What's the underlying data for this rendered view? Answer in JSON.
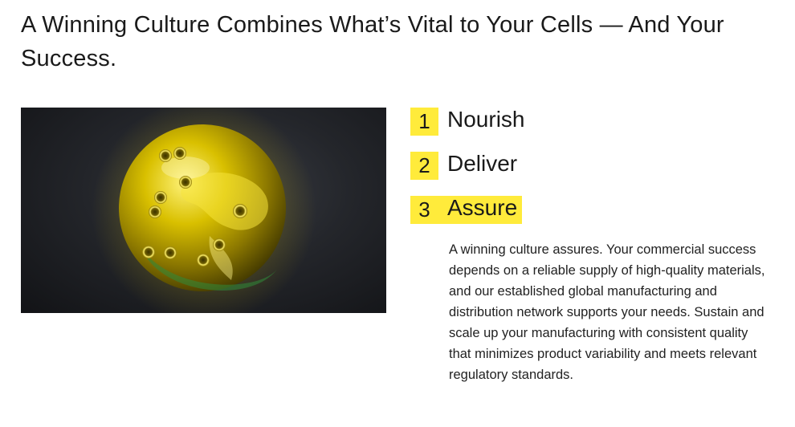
{
  "headline": "A Winning Culture Combines What’s Vital to Your Cells — And Your Success.",
  "steps": [
    {
      "number": "1",
      "label": "Nourish"
    },
    {
      "number": "2",
      "label": "Deliver"
    },
    {
      "number": "3",
      "label": "Assure"
    }
  ],
  "active_step": 3,
  "description": "A winning culture assures. Your commercial success depends on a reliable supply of high-quality materials, and our established global manufacturing and distribution network supports your needs. Sustain and scale up your manufacturing with consistent quality that minimizes product variability and meets relevant regulatory standards.",
  "colors": {
    "accent": "#ffeb3b",
    "text": "#1a1a1a",
    "image_background": "#24262b",
    "sphere": "#c9b400"
  },
  "image": {
    "subject": "golden-cell-sphere"
  }
}
